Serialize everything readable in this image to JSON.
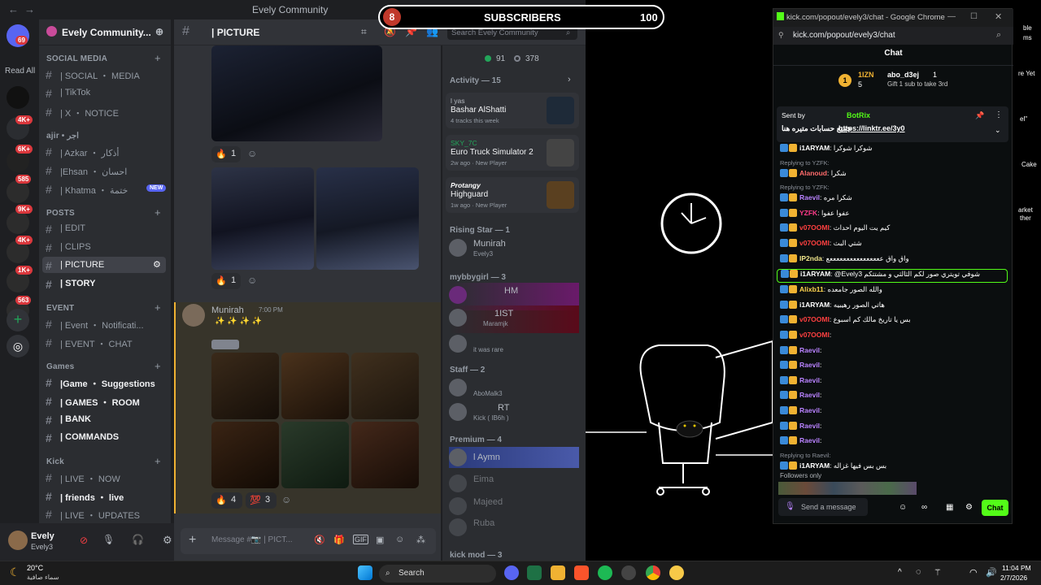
{
  "discord": {
    "window_title": "Evely Community",
    "read_all": "Read All",
    "rail_badges": [
      "69",
      "4K+",
      "6K+",
      "585",
      "9K+",
      "4K+",
      "1K+",
      "563"
    ],
    "server_name": "Evely Community...",
    "categories": [
      {
        "label": "SOCIAL MEDIA",
        "channels": [
          "| SOCIAL ・ MEDIA",
          "| TikTok",
          "| X ・ NOTICE"
        ]
      },
      {
        "label": "ajir • اجر",
        "channels": [
          "| Azkar ・ أذكار",
          "|Ehsan ・ احسان",
          "| Khatma ・ ختمة"
        ]
      },
      {
        "label": "POSTS",
        "channels": [
          "| EDIT",
          "| CLIPS",
          "| PICTURE",
          "| STORY"
        ]
      },
      {
        "label": "EVENT",
        "channels": [
          "| Event ・ Notificati...",
          "| EVENT ・ CHAT"
        ]
      },
      {
        "label": "Games",
        "channels": [
          "|Game ・ Suggestions",
          "| GAMES ・ ROOM",
          "| BANK",
          "| COMMANDS"
        ]
      },
      {
        "label": "Kick",
        "channels": [
          "| LIVE ・ NOW",
          "| friends ・ live",
          "| LIVE ・ UPDATES"
        ]
      }
    ],
    "new_badge": "NEW",
    "current_channel": "| PICTURE",
    "search_placeholder": "Search Evely Community",
    "messages": {
      "reactions": [
        {
          "emoji": "🔥",
          "count": "1"
        },
        {
          "emoji": "🔥",
          "count": "1"
        },
        {
          "emoji": "🔥",
          "count": "4"
        },
        {
          "emoji": "💯",
          "count": "3"
        }
      ],
      "author": "Munirah",
      "time": "7:00 PM",
      "body": "✨ ✨ ✨ ✨"
    },
    "composer_placeholder": "Message #📷 | PICT...",
    "user": {
      "name": "Evely",
      "tag": "Evely3"
    },
    "members": {
      "online_count": "91",
      "offline_count": "378",
      "activity_header": "Activity — 15",
      "activities": [
        {
          "top": "l yas",
          "title": "Bashar AlShatti",
          "meta": "4 tracks this week"
        },
        {
          "top": "SKY_7C",
          "title": "Euro Truck Simulator 2",
          "meta": "2w ago · New Player"
        },
        {
          "top": "Protangy",
          "title": "Highguard",
          "meta": "1w ago · New Player"
        }
      ],
      "groups": [
        {
          "label": "Rising Star — 1",
          "members": [
            {
              "name": "Munirah",
              "status": "Evely3"
            }
          ]
        },
        {
          "label": "mybbygirl — 3",
          "members": [
            {
              "name": "HM",
              "status": ""
            },
            {
              "name": "1IST",
              "status": "Maramjk"
            },
            {
              "name": "",
              "status": "it was rare"
            }
          ]
        },
        {
          "label": "Staff — 2",
          "members": [
            {
              "name": "",
              "status": "AboMalk3"
            },
            {
              "name": "RT",
              "status": "Kick ( IB6h )"
            }
          ]
        },
        {
          "label": "Premium — 4",
          "members": [
            {
              "name": "l Aymn",
              "status": ""
            },
            {
              "name": "Eima",
              "status": ""
            },
            {
              "name": "Majeed",
              "status": ""
            },
            {
              "name": "Ruba",
              "status": ""
            }
          ]
        },
        {
          "label": "kick mod — 3",
          "members": []
        }
      ]
    }
  },
  "overlay": {
    "sub_count": "8",
    "label": "SUBSCRIBERS",
    "goal": "100"
  },
  "chrome": {
    "window_title": "kick.com/popout/evely3/chat - Google Chrome",
    "url": "kick.com/popout/evely3/chat",
    "chat_title": "Chat",
    "leaderboard": {
      "first": "1IZN",
      "first_count": "5",
      "second": "abo_d3ej",
      "second_count": "1",
      "gift_text": "Gift 1 sub to take 3rd"
    },
    "pinned": {
      "sent_by": "Sent by",
      "bot": "BotRix",
      "text": "جميع حسابات متيره هنا",
      "link": "https://linktr.ee/3y0"
    },
    "messages": [
      {
        "user": "i1ARYAM",
        "color": "#ffffff",
        "text": "شوكرا شوكرا",
        "reply": ""
      },
      {
        "user": "Alanoud",
        "color": "#ff6b6b",
        "text": "شكرا",
        "reply": "Replying to YZFK:"
      },
      {
        "user": "Raevil",
        "color": "#b983ff",
        "text": "شكرا مره",
        "reply": "Replying to YZFK:"
      },
      {
        "user": "YZFK",
        "color": "#ff3b8a",
        "text": "عفوا عفوا",
        "reply": ""
      },
      {
        "user": "v07OOMI",
        "color": "#ff4040",
        "text": "كيم يت اليوم احداث",
        "reply": ""
      },
      {
        "user": "v07OOMI",
        "color": "#ff4040",
        "text": "شتي البث",
        "reply": ""
      },
      {
        "user": "IP2nda",
        "color": "#f0e68c",
        "text": "واق واق ععععععععععععععععع",
        "reply": ""
      },
      {
        "user": "i1ARYAM",
        "color": "#ffffff",
        "text": "@Evely3 شوفي تويتري صور لكم الثالثي و مشتتكم",
        "reply": "",
        "highlight": true
      },
      {
        "user": "Alixb11",
        "color": "#ffd54f",
        "text": "والله الصور جامعده",
        "reply": ""
      },
      {
        "user": "i1ARYAM",
        "color": "#ffffff",
        "text": "هاتي الصور رهيبيه",
        "reply": ""
      },
      {
        "user": "v07OOMI",
        "color": "#ff4040",
        "text": "بس يا تاريخ مالك كم اسبوع",
        "reply": ""
      },
      {
        "user": "v07OOMI",
        "color": "#ff4040",
        "text": "",
        "reply": ""
      },
      {
        "user": "Raevil",
        "color": "#b983ff",
        "text": "",
        "reply": ""
      },
      {
        "user": "Raevil",
        "color": "#b983ff",
        "text": "",
        "reply": ""
      },
      {
        "user": "Raevil",
        "color": "#b983ff",
        "text": "",
        "reply": ""
      },
      {
        "user": "Raevil",
        "color": "#b983ff",
        "text": "",
        "reply": ""
      },
      {
        "user": "Raevil",
        "color": "#b983ff",
        "text": "",
        "reply": ""
      },
      {
        "user": "Raevil",
        "color": "#b983ff",
        "text": "",
        "reply": ""
      },
      {
        "user": "Raevil",
        "color": "#b983ff",
        "text": "",
        "reply": ""
      },
      {
        "user": "i1ARYAM",
        "color": "#ffffff",
        "text": "بس بس فيها غزاله",
        "reply": "Replying to Raevil:"
      }
    ],
    "followers_only": "Followers only",
    "input_placeholder": "Send a message",
    "send_label": "Chat"
  },
  "desktop_labels": [
    "ble",
    "ms",
    "re Yet",
    "el\"",
    "Cake",
    "arket",
    "ther"
  ],
  "taskbar": {
    "weather_temp": "20°C",
    "weather_text": "سماء صافية",
    "search_label": "Search",
    "time": "11:04 PM",
    "date": "2/7/2026"
  },
  "colors": {
    "discord_bg": "#313338",
    "kick_green": "#53fc18",
    "accent_blurple": "#5865f2"
  }
}
